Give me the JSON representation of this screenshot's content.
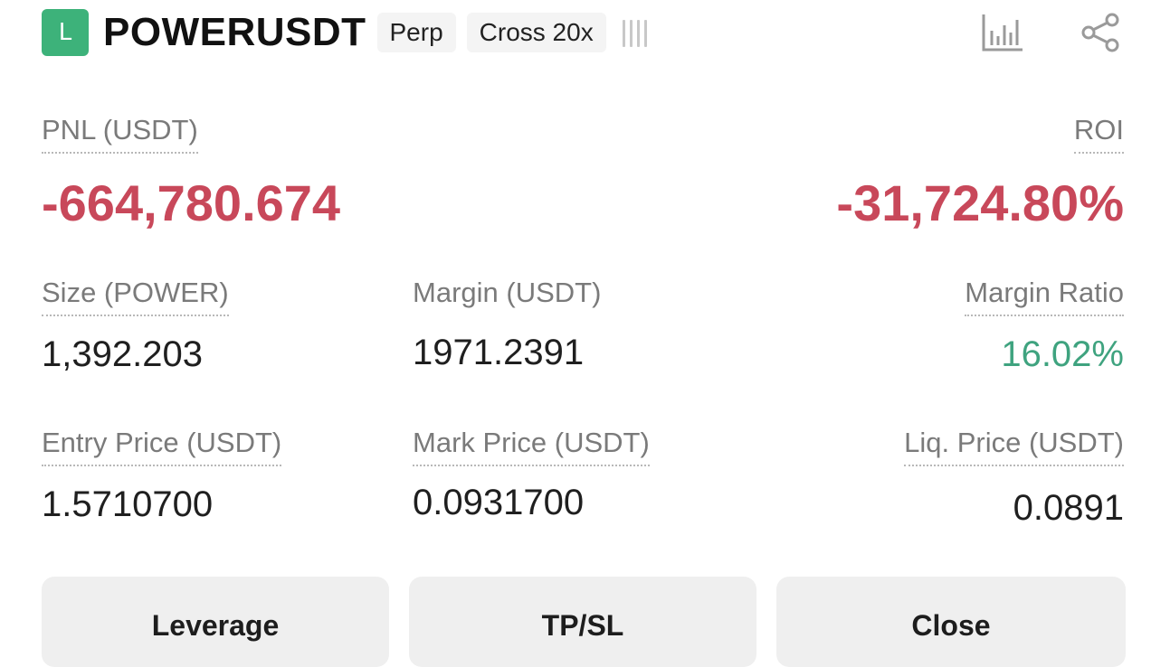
{
  "header": {
    "side_badge": "L",
    "symbol": "POWERUSDT",
    "contract_type": "Perp",
    "margin_mode": "Cross 20x",
    "icons": [
      "bar-chart-icon",
      "share-icon"
    ]
  },
  "pnl": {
    "label": "PNL (USDT)",
    "value": "-664,780.674"
  },
  "roi": {
    "label": "ROI",
    "value": "-31,724.80%"
  },
  "size": {
    "label": "Size (POWER)",
    "value": "1,392.203"
  },
  "margin": {
    "label": "Margin (USDT)",
    "value": "1971.2391"
  },
  "margin_ratio": {
    "label": "Margin Ratio",
    "value": "16.02%"
  },
  "entry_price": {
    "label": "Entry Price (USDT)",
    "value": "1.5710700"
  },
  "mark_price": {
    "label": "Mark Price (USDT)",
    "value": "0.0931700"
  },
  "liq_price": {
    "label": "Liq. Price (USDT)",
    "value": "0.0891"
  },
  "actions": {
    "leverage": "Leverage",
    "tpsl": "TP/SL",
    "close": "Close"
  },
  "colors": {
    "negative": "#c8485a",
    "positive": "#3fa37f",
    "long_badge": "#3db27a"
  }
}
